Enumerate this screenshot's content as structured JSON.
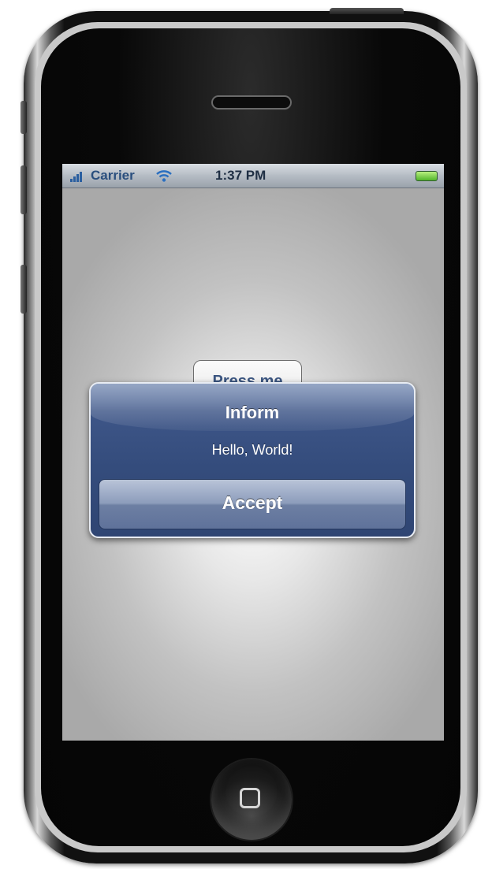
{
  "status_bar": {
    "carrier": "Carrier",
    "time": "1:37 PM",
    "icons": [
      "signal-icon",
      "wifi-icon",
      "battery-icon"
    ]
  },
  "app": {
    "press_button_label": "Press me"
  },
  "alert": {
    "title": "Inform",
    "message": "Hello, World!",
    "button_label": "Accept"
  },
  "colors": {
    "alert_background": "#344c7c",
    "alert_button": "#8c9cbb",
    "status_text": "#2a4f7e"
  }
}
